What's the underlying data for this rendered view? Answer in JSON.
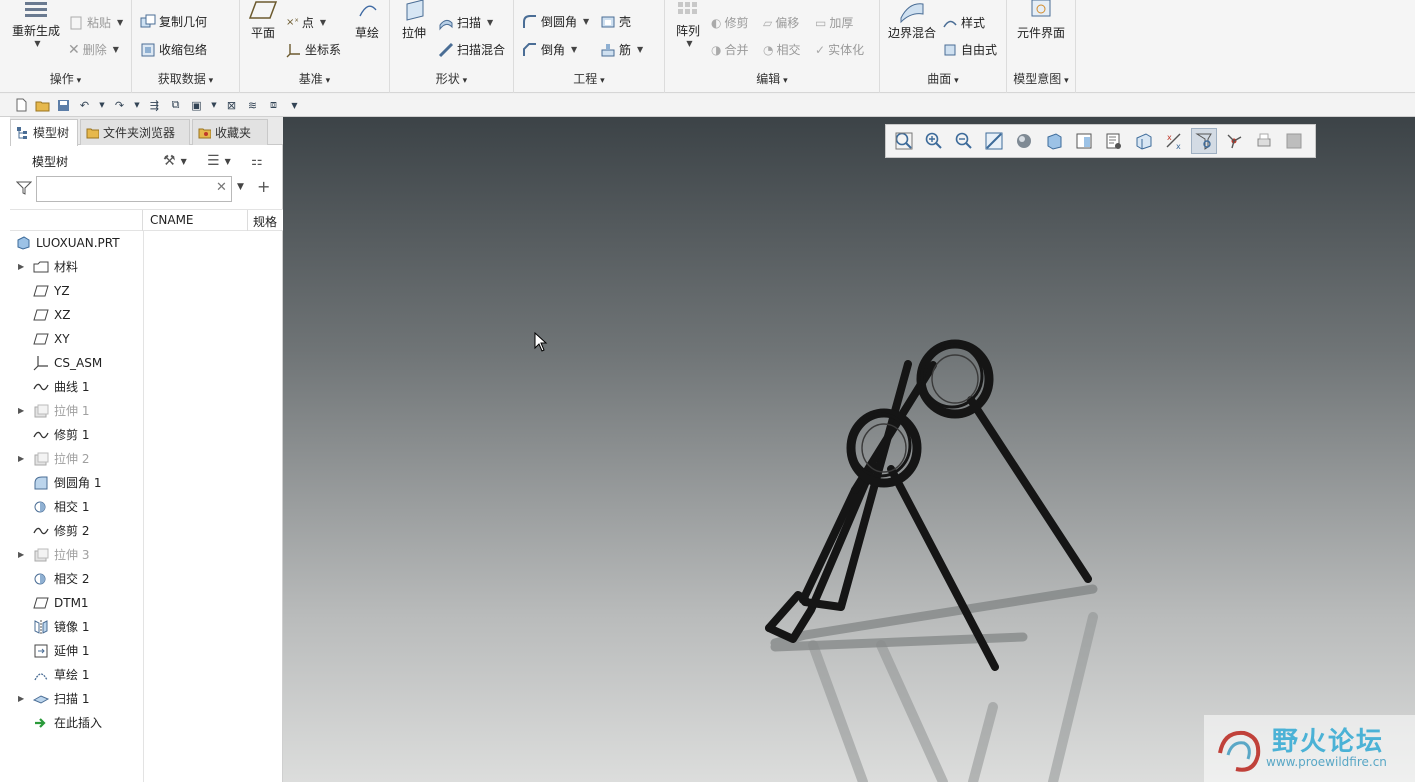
{
  "ribbon": {
    "groups": {
      "operations": {
        "label": "操作",
        "regenerate": "重新生成",
        "paste": "粘贴",
        "delete": "删除"
      },
      "get_data": {
        "label": "获取数据",
        "copy_geometry": "复制几何",
        "shrinkwrap": "收缩包络"
      },
      "datum": {
        "label": "基准",
        "plane": "平面",
        "point": "点",
        "csys": "坐标系",
        "sketch": "草绘"
      },
      "shapes": {
        "label": "形状",
        "extrude": "拉伸",
        "sweep": "扫描",
        "swept_blend": "扫描混合"
      },
      "engineering": {
        "label": "工程",
        "round": "倒圆角",
        "chamfer": "倒角",
        "shell": "壳",
        "rib": "筋"
      },
      "editing": {
        "label": "编辑",
        "pattern": "阵列",
        "trim": "修剪",
        "offset": "偏移",
        "thicken": "加厚",
        "merge": "合并",
        "intersect": "相交",
        "solidify": "实体化"
      },
      "surfaces": {
        "label": "曲面",
        "boundary_blend": "边界混合",
        "style": "样式",
        "freestyle": "自由式"
      },
      "model_intent": {
        "label": "模型意图",
        "component_interface": "元件界面"
      }
    }
  },
  "left_panel": {
    "tabs": [
      {
        "label": "模型树"
      },
      {
        "label": "文件夹浏览器"
      },
      {
        "label": "收藏夹"
      }
    ],
    "tree_title": "模型树",
    "search": {
      "value": "",
      "placeholder": ""
    },
    "columns": {
      "c2": "CNAME",
      "c3": "规格"
    },
    "rows": [
      {
        "label": "LUOXUAN.PRT",
        "icon": "part-icon"
      },
      {
        "label": "材料",
        "icon": "material-icon"
      },
      {
        "label": "YZ",
        "icon": "datum-plane-icon"
      },
      {
        "label": "XZ",
        "icon": "datum-plane-icon"
      },
      {
        "label": "XY",
        "icon": "datum-plane-icon"
      },
      {
        "label": "CS_ASM",
        "icon": "csys-icon"
      },
      {
        "label": "曲线 1",
        "icon": "curve-icon"
      },
      {
        "label": "拉伸 1",
        "icon": "extrude-icon"
      },
      {
        "label": "修剪 1",
        "icon": "curve-icon"
      },
      {
        "label": "拉伸 2",
        "icon": "extrude-icon"
      },
      {
        "label": "倒圆角 1",
        "icon": "round-icon"
      },
      {
        "label": "相交 1",
        "icon": "intersect-icon"
      },
      {
        "label": "修剪 2",
        "icon": "curve-icon"
      },
      {
        "label": "拉伸 3",
        "icon": "extrude-icon"
      },
      {
        "label": "相交 2",
        "icon": "intersect-icon"
      },
      {
        "label": "DTM1",
        "icon": "datum-plane-icon"
      },
      {
        "label": "镜像 1",
        "icon": "mirror-icon"
      },
      {
        "label": "延伸 1",
        "icon": "extend-icon"
      },
      {
        "label": "草绘 1",
        "icon": "sketch-icon"
      },
      {
        "label": "扫描 1",
        "icon": "sweep-icon"
      },
      {
        "label": "在此插入",
        "icon": "insert-here-icon"
      }
    ]
  },
  "watermark": {
    "title": "野火论坛",
    "url": "www.proewildfire.cn"
  },
  "colors": {
    "accent": "#4bb2d6",
    "viewport_top": "#3c4347",
    "viewport_bottom": "#dcdddc",
    "model": "#1a1a1a"
  }
}
